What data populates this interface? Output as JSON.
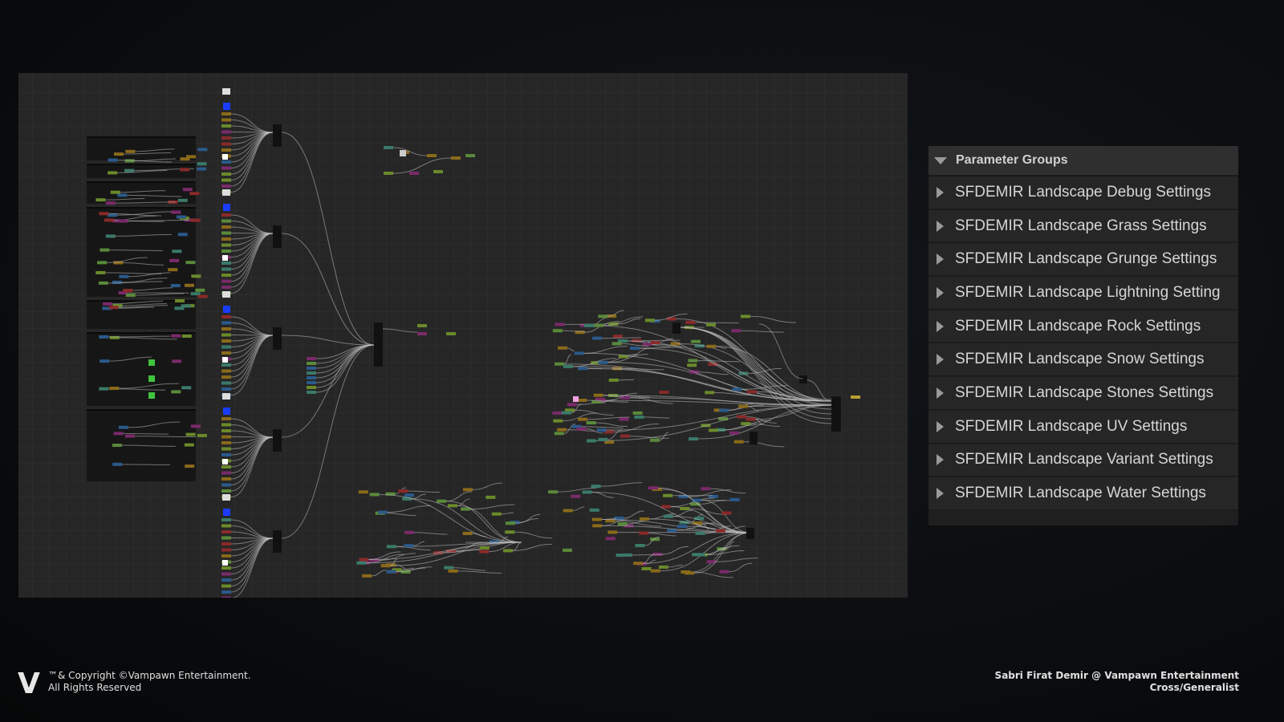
{
  "panel": {
    "title": "Parameter Groups",
    "items": [
      {
        "label": "SFDEMIR Landscape Debug Settings"
      },
      {
        "label": "SFDEMIR Landscape Grass Settings"
      },
      {
        "label": "SFDEMIR Landscape Grunge Settings"
      },
      {
        "label": "SFDEMIR Landscape Lightning Setting"
      },
      {
        "label": "SFDEMIR Landscape Rock Settings"
      },
      {
        "label": "SFDEMIR Landscape Snow Settings"
      },
      {
        "label": "SFDEMIR Landscape Stones Settings"
      },
      {
        "label": "SFDEMIR Landscape UV Settings"
      },
      {
        "label": "SFDEMIR Landscape Variant Settings"
      },
      {
        "label": "SFDEMIR Landscape Water Settings"
      }
    ]
  },
  "footer": {
    "logo": "V",
    "copyright_line1": "™& Copyright ©Vampawn Entertainment.",
    "copyright_line2": "All Rights Reserved",
    "author_line1": "Sabri Firat Demir @ Vampawn Entertainment",
    "author_line2": "Cross/Generalist"
  },
  "colors": {
    "pins": [
      "#6a8a2a",
      "#3a7a6a",
      "#7a2a6a",
      "#8a6a1a",
      "#2a5a8a",
      "#8a2a2a",
      "#5a8a3a"
    ],
    "wire": "#bdbdbd",
    "node": "#111111"
  }
}
